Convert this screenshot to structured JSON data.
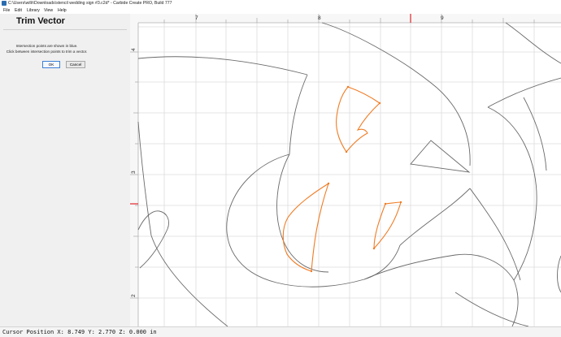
{
  "window": {
    "title": "C:\\Users\\willr\\Downloads\\stencil wedding sign #3.c2d* - Carbide Create PRO, Build 777"
  },
  "menu": {
    "items": [
      "File",
      "Edit",
      "Library",
      "View",
      "Help"
    ]
  },
  "panel": {
    "title": "Trim Vector",
    "help_line1": "Intersection points are shown in blue.",
    "help_line2": "Click between intersection points to trim a vector.",
    "ok_label": "OK",
    "cancel_label": "Cancel"
  },
  "ruler": {
    "x_labels": [
      "7",
      "8",
      "9"
    ],
    "y_labels": [
      "4",
      "3",
      "2"
    ]
  },
  "status": {
    "cursor_text": "Cursor Position X: 8.749 Y: 2.770 Z: 0.000 in"
  },
  "colors": {
    "trim_preview": "#f07c24",
    "vector": "#6a6a6a",
    "grid": "#dcdcdc",
    "cursor_marker": "#e0242a"
  }
}
